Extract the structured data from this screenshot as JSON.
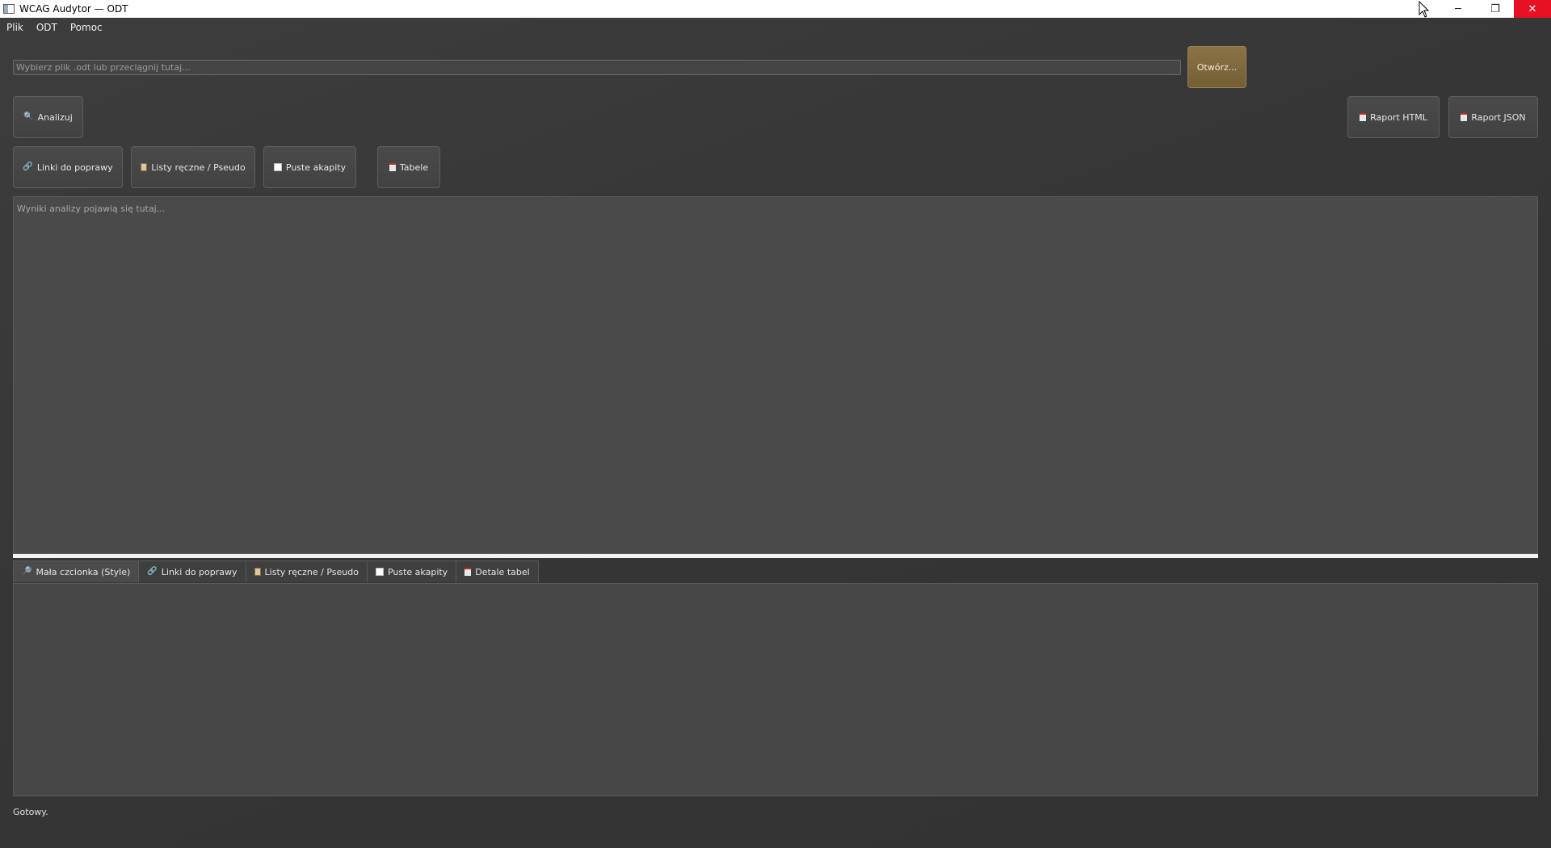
{
  "window": {
    "title": "WCAG Audytor — ODT",
    "controls": {
      "minimize": "─",
      "restore": "❐",
      "close": "✕"
    }
  },
  "menu": {
    "items": [
      "Plik",
      "ODT",
      "Pomoc"
    ]
  },
  "file": {
    "placeholder": "Wybierz plik .odt lub przeciągnij tutaj...",
    "value": "",
    "open_label": "Otwórz..."
  },
  "toolbar": {
    "analyze_label": "Analizuj",
    "report_html_label": "Raport HTML",
    "report_json_label": "Raport JSON"
  },
  "fix_buttons": {
    "links_label": "Linki do poprawy",
    "lists_label": "Listy ręczne / Pseudo",
    "empty_label": "Puste akapity",
    "tables_label": "Tabele"
  },
  "results": {
    "placeholder": "Wyniki analizy pojawią się tutaj..."
  },
  "tabs": [
    {
      "label": "Mała czcionka (Style)",
      "icon": "magnifier-icon",
      "active": true
    },
    {
      "label": "Linki do poprawy",
      "icon": "link-icon",
      "active": false
    },
    {
      "label": "Listy ręczne / Pseudo",
      "icon": "clipboard-icon",
      "active": false
    },
    {
      "label": "Puste akapity",
      "icon": "empty-box-icon",
      "active": false
    },
    {
      "label": "Detale tabel",
      "icon": "document-icon",
      "active": false
    }
  ],
  "status": {
    "text": "Gotowy."
  },
  "colors": {
    "background": "#383838",
    "accent_button": "#7f6a3e",
    "close_button": "#e81123",
    "splitter": "#f2f2f2"
  }
}
